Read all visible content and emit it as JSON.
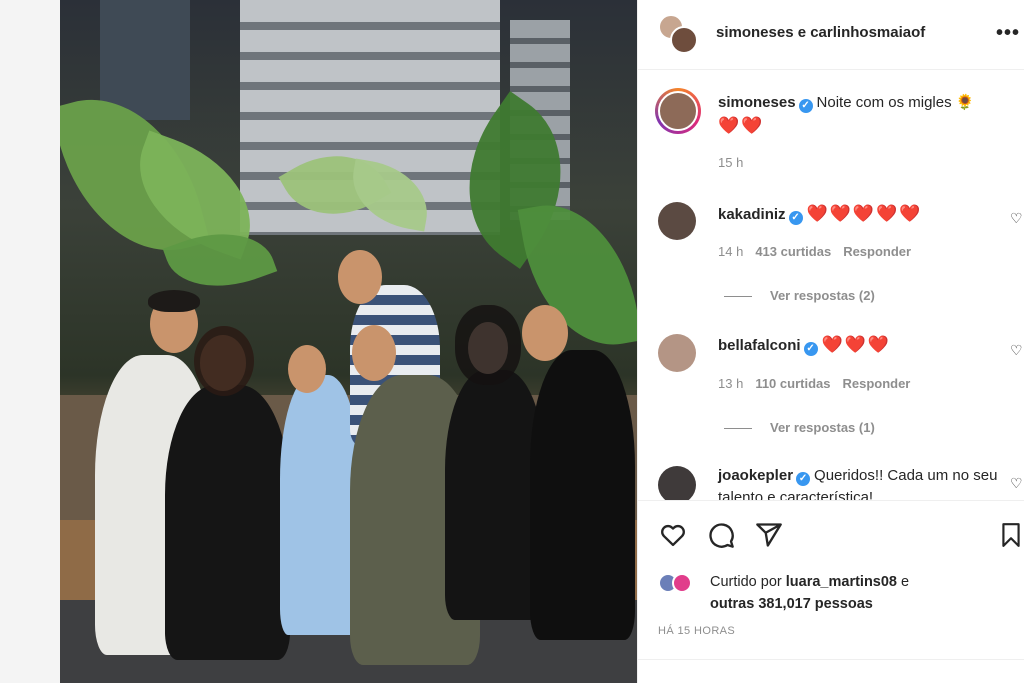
{
  "header": {
    "users": "simoneses e carlinhosmaiaof",
    "more_icon": "more-horizontal-icon"
  },
  "caption": {
    "username": "simoneses",
    "text": "Noite com os migles 🌻",
    "hearts": "❤️❤️",
    "time": "15 h"
  },
  "comments": [
    {
      "username": "kakadiniz",
      "verified": true,
      "text": "❤️❤️❤️❤️❤️",
      "time": "14 h",
      "likes": "413 curtidas",
      "reply": "Responder",
      "replies": "Ver respostas (2)"
    },
    {
      "username": "bellafalconi",
      "verified": true,
      "text": "❤️❤️❤️",
      "time": "13 h",
      "likes": "110 curtidas",
      "reply": "Responder",
      "replies": "Ver respostas (1)"
    },
    {
      "username": "joaokepler",
      "verified": true,
      "text": "Queridos!! Cada um no seu talento e característica!"
    }
  ],
  "actions": {
    "like_icon": "heart-outline-icon",
    "comment_icon": "comment-icon",
    "share_icon": "send-icon",
    "save_icon": "bookmark-icon"
  },
  "liked_by": {
    "prefix": "Curtido por ",
    "user": "luara_martins08",
    "middle": " e",
    "others": "outras 381,017 pessoas"
  },
  "timestamp": "HÁ 15 HORAS",
  "colors": {
    "verified": "#3897f0",
    "heart": "#e0245e",
    "meta": "#8e8e8e"
  }
}
